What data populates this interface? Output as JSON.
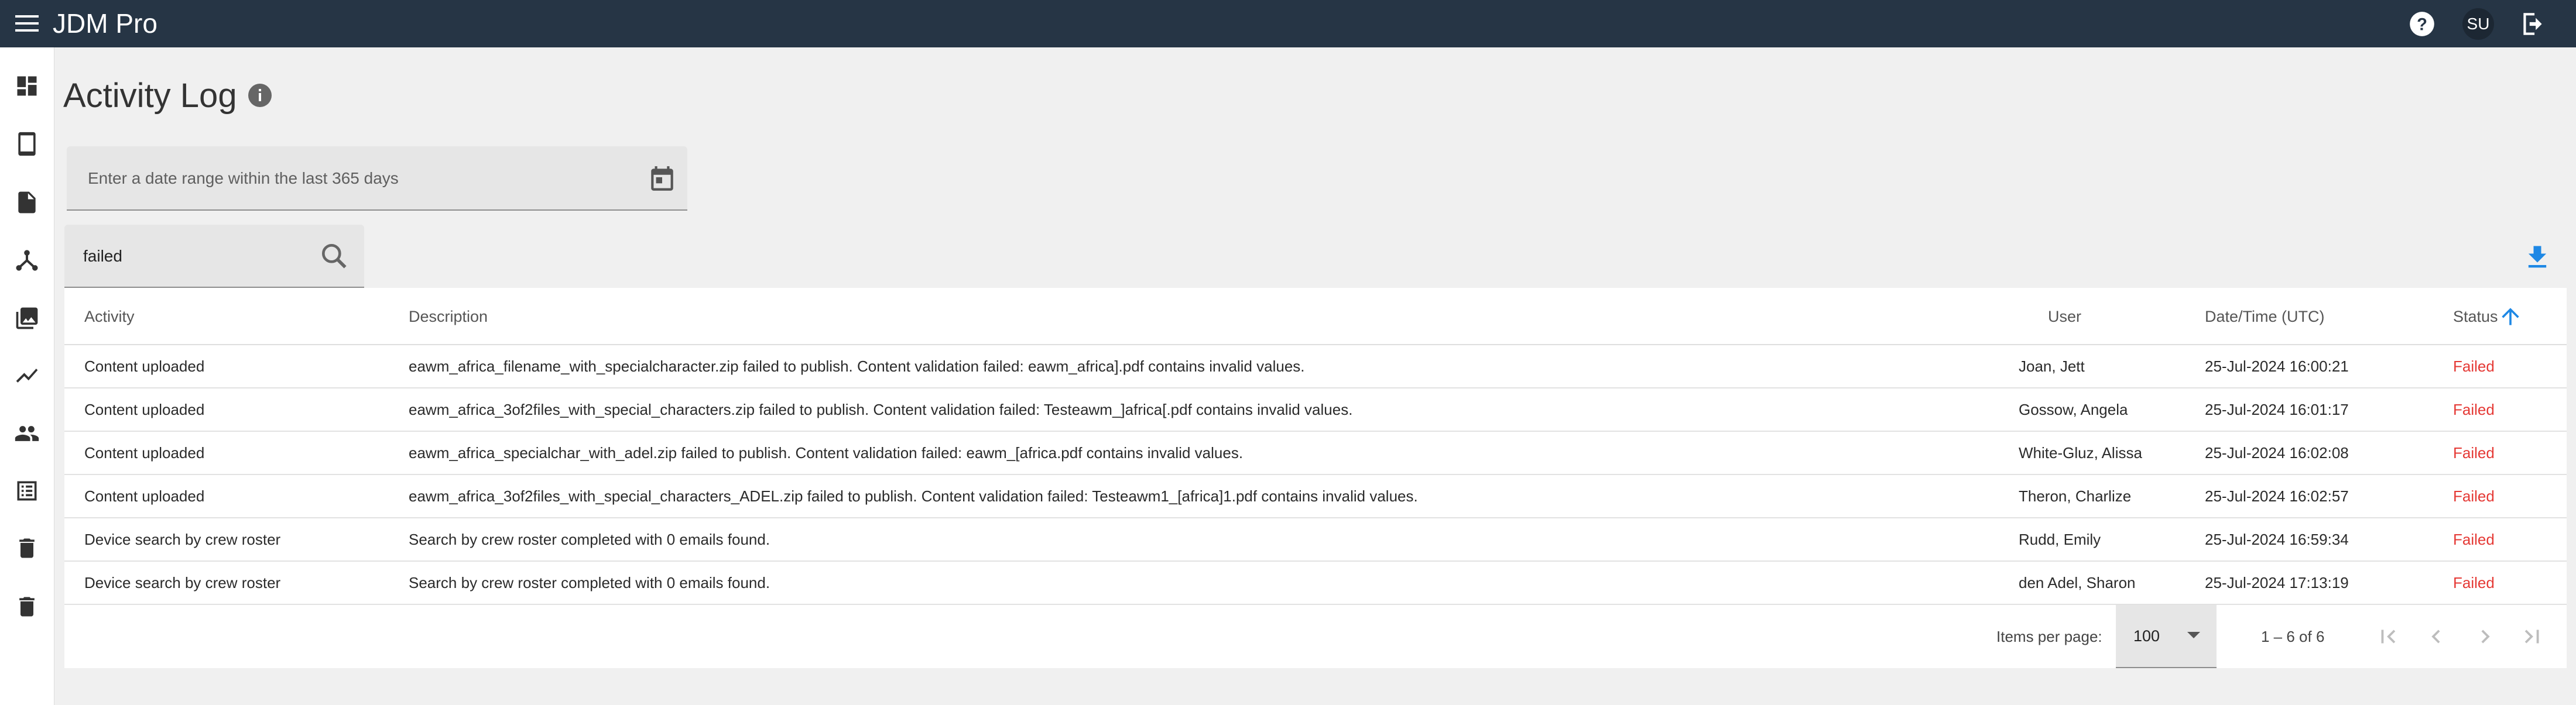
{
  "app": {
    "title": "JDM Pro"
  },
  "header": {
    "user_initials": "SU"
  },
  "sidebar": {
    "items": [
      {
        "name": "dashboard"
      },
      {
        "name": "devices"
      },
      {
        "name": "documents"
      },
      {
        "name": "distribution"
      },
      {
        "name": "media"
      },
      {
        "name": "analytics"
      },
      {
        "name": "users"
      },
      {
        "name": "activity-log"
      },
      {
        "name": "trash"
      },
      {
        "name": "trash-2"
      }
    ]
  },
  "page": {
    "title": "Activity Log"
  },
  "filters": {
    "date_range_placeholder": "Enter a date range within the last 365 days",
    "search_value": "failed"
  },
  "table": {
    "columns": {
      "activity": "Activity",
      "description": "Description",
      "user": "User",
      "datetime": "Date/Time (UTC)",
      "status": "Status"
    },
    "rows": [
      {
        "activity": "Content uploaded",
        "description": "eawm_africa_filename_with_specialcharacter.zip failed to publish. Content validation failed: eawm_africa].pdf contains invalid values.",
        "user": "Joan, Jett",
        "datetime": "25-Jul-2024 16:00:21",
        "status": "Failed"
      },
      {
        "activity": "Content uploaded",
        "description": "eawm_africa_3of2files_with_special_characters.zip failed to publish. Content validation failed: Testeawm_]africa[.pdf contains invalid values.",
        "user": "Gossow, Angela",
        "datetime": "25-Jul-2024 16:01:17",
        "status": "Failed"
      },
      {
        "activity": "Content uploaded",
        "description": "eawm_africa_specialchar_with_adel.zip failed to publish. Content validation failed: eawm_[africa.pdf contains invalid values.",
        "user": "White-Gluz, Alissa",
        "datetime": "25-Jul-2024 16:02:08",
        "status": "Failed"
      },
      {
        "activity": "Content uploaded",
        "description": "eawm_africa_3of2files_with_special_characters_ADEL.zip failed to publish. Content validation failed: Testeawm1_[africa]1.pdf contains invalid values.",
        "user": "Theron, Charlize",
        "datetime": "25-Jul-2024 16:02:57",
        "status": "Failed"
      },
      {
        "activity": "Device search by crew roster",
        "description": "Search by crew roster completed with 0 emails found.",
        "user": "Rudd, Emily",
        "datetime": "25-Jul-2024 16:59:34",
        "status": "Failed"
      },
      {
        "activity": "Device search by crew roster",
        "description": "Search by crew roster completed with 0 emails found.",
        "user": "den Adel, Sharon",
        "datetime": "25-Jul-2024 17:13:19",
        "status": "Failed"
      }
    ]
  },
  "paginator": {
    "items_per_page_label": "Items per page:",
    "items_per_page_value": "100",
    "range_label": "1 – 6 of 6"
  },
  "colors": {
    "topbar": "#263545",
    "status_failed": "#e53935",
    "accent": "#1e88e5"
  }
}
